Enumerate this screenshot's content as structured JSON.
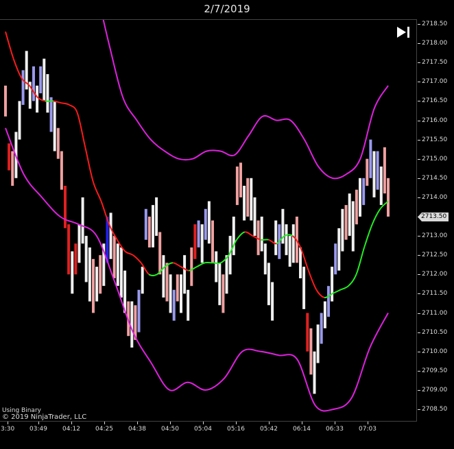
{
  "window": {
    "title": "2/7/2019"
  },
  "footer": {
    "binary_label": "Using Binary",
    "copyright": "© 2019 NinjaTrader, LLC"
  },
  "controls": {
    "scroll_to_end_icon": "skip-to-end-icon"
  },
  "current_price_label": "2713.50",
  "colors": {
    "background": "#000000",
    "upper_band": "#e020e0",
    "lower_band": "#e020e0",
    "ma_down": "#ff1a1a",
    "ma_up": "#22ee22",
    "bar_light": "#f0f0f0",
    "bar_pink": "#f0a0a0",
    "bar_blue": "#9999ee",
    "bar_red": "#e02020",
    "bar_darkblue": "#2222ee"
  },
  "chart_data": {
    "type": "bar",
    "x_axis_labels": [
      "3:30",
      "03:49",
      "04:12",
      "04:25",
      "04:38",
      "04:50",
      "05:04",
      "05:16",
      "05:42",
      "06:14",
      "06:33",
      "07:03"
    ],
    "y_axis_labels": [
      "2718.50",
      "2718.00",
      "2717.50",
      "2717.00",
      "2716.50",
      "2716.00",
      "2715.50",
      "2715.00",
      "2714.50",
      "2714.00",
      "2713.50",
      "2713.00",
      "2712.50",
      "2712.00",
      "2711.50",
      "2711.00",
      "2710.50",
      "2710.00",
      "2709.50",
      "2709.00",
      "2708.50"
    ],
    "ylim": [
      2708.35,
      2718.6
    ],
    "last_price": 2713.5,
    "bar_count": 94,
    "bars": [
      [
        2716.1,
        2716.9,
        "p"
      ],
      [
        2714.7,
        2715.4,
        "r"
      ],
      [
        2714.3,
        2715.2,
        "p"
      ],
      [
        2714.5,
        2715.7,
        "w"
      ],
      [
        2715.5,
        2716.5,
        "w"
      ],
      [
        2716.4,
        2717.3,
        "b"
      ],
      [
        2716.8,
        2717.8,
        "w"
      ],
      [
        2716.3,
        2717.0,
        "w"
      ],
      [
        2716.5,
        2717.4,
        "b"
      ],
      [
        2716.2,
        2716.9,
        "w"
      ],
      [
        2716.7,
        2717.4,
        "b"
      ],
      [
        2716.5,
        2717.6,
        "w"
      ],
      [
        2716.2,
        2717.2,
        "w"
      ],
      [
        2715.7,
        2716.6,
        "b"
      ],
      [
        2715.2,
        2716.5,
        "w"
      ],
      [
        2715.0,
        2715.8,
        "p"
      ],
      [
        2714.2,
        2715.2,
        "p"
      ],
      [
        2713.2,
        2714.3,
        "r"
      ],
      [
        2712.0,
        2713.3,
        "r"
      ],
      [
        2711.5,
        2712.6,
        "w"
      ],
      [
        2712.0,
        2712.8,
        "r"
      ],
      [
        2712.3,
        2713.3,
        "w"
      ],
      [
        2712.8,
        2714.0,
        "w"
      ],
      [
        2711.8,
        2713.0,
        "w"
      ],
      [
        2711.3,
        2712.7,
        "w"
      ],
      [
        2711.0,
        2712.4,
        "p"
      ],
      [
        2711.3,
        2712.2,
        "w"
      ],
      [
        2711.5,
        2712.5,
        "p"
      ],
      [
        2711.7,
        2712.8,
        "w"
      ],
      [
        2712.3,
        2713.5,
        "d"
      ],
      [
        2712.4,
        2713.6,
        "w"
      ],
      [
        2711.9,
        2713.0,
        "p"
      ],
      [
        2711.7,
        2712.8,
        "w"
      ],
      [
        2711.4,
        2712.7,
        "w"
      ],
      [
        2711.0,
        2712.1,
        "w"
      ],
      [
        2710.4,
        2711.3,
        "p"
      ],
      [
        2710.1,
        2711.3,
        "w"
      ],
      [
        2710.3,
        2711.2,
        "p"
      ],
      [
        2710.5,
        2711.6,
        "b"
      ],
      [
        2711.5,
        2712.2,
        "w"
      ],
      [
        2712.9,
        2713.7,
        "b"
      ],
      [
        2712.7,
        2713.5,
        "p"
      ],
      [
        2712.7,
        2713.8,
        "w"
      ],
      [
        2713.0,
        2714.0,
        "w"
      ],
      [
        2712.0,
        2713.1,
        "p"
      ],
      [
        2711.4,
        2712.5,
        "w"
      ],
      [
        2711.3,
        2712.3,
        "p"
      ],
      [
        2711.0,
        2712.0,
        "w"
      ],
      [
        2710.8,
        2711.6,
        "b"
      ],
      [
        2711.3,
        2712.0,
        "p"
      ],
      [
        2711.0,
        2712.0,
        "w"
      ],
      [
        2711.5,
        2712.5,
        "w"
      ],
      [
        2710.8,
        2711.6,
        "w"
      ],
      [
        2711.7,
        2712.7,
        "p"
      ],
      [
        2712.4,
        2713.3,
        "r"
      ],
      [
        2712.7,
        2713.4,
        "b"
      ],
      [
        2712.3,
        2713.3,
        "w"
      ],
      [
        2712.9,
        2713.7,
        "b"
      ],
      [
        2712.8,
        2713.9,
        "w"
      ],
      [
        2712.3,
        2713.4,
        "p"
      ],
      [
        2711.8,
        2712.6,
        "w"
      ],
      [
        2711.2,
        2712.3,
        "w"
      ],
      [
        2711.0,
        2712.0,
        "p"
      ],
      [
        2711.5,
        2712.5,
        "w"
      ],
      [
        2712.0,
        2713.0,
        "w"
      ],
      [
        2712.5,
        2713.5,
        "w"
      ],
      [
        2713.8,
        2714.8,
        "p"
      ],
      [
        2714.0,
        2714.9,
        "p"
      ],
      [
        2713.4,
        2714.3,
        "w"
      ],
      [
        2713.5,
        2714.5,
        "p"
      ],
      [
        2713.4,
        2714.5,
        "w"
      ],
      [
        2713.0,
        2714.0,
        "w"
      ],
      [
        2712.5,
        2713.4,
        "p"
      ],
      [
        2712.6,
        2713.5,
        "w"
      ],
      [
        2712.0,
        2712.8,
        "w"
      ],
      [
        2711.2,
        2712.3,
        "w"
      ],
      [
        2710.8,
        2711.8,
        "w"
      ],
      [
        2712.5,
        2713.4,
        "w"
      ],
      [
        2712.4,
        2713.3,
        "b"
      ],
      [
        2712.8,
        2713.7,
        "w"
      ],
      [
        2712.5,
        2713.3,
        "w"
      ],
      [
        2712.2,
        2713.0,
        "w"
      ],
      [
        2712.3,
        2713.3,
        "w"
      ],
      [
        2712.3,
        2713.5,
        "p"
      ],
      [
        2711.9,
        2712.7,
        "w"
      ],
      [
        2711.1,
        2712.2,
        "w"
      ],
      [
        2710.0,
        2711.0,
        "r"
      ],
      [
        2709.4,
        2710.6,
        "p"
      ],
      [
        2708.9,
        2710.0,
        "w"
      ],
      [
        2709.7,
        2710.7,
        "w"
      ]
    ],
    "bars_tail": [
      [
        2710.2,
        2711.0,
        "b"
      ],
      [
        2710.6,
        2711.3,
        "w"
      ],
      [
        2710.9,
        2711.7,
        "b"
      ],
      [
        2711.3,
        2712.2,
        "w"
      ],
      [
        2712.0,
        2712.8,
        "b"
      ],
      [
        2712.1,
        2713.2,
        "w"
      ],
      [
        2712.6,
        2713.7,
        "w"
      ],
      [
        2712.9,
        2713.8,
        "p"
      ],
      [
        2713.0,
        2714.1,
        "w"
      ],
      [
        2712.6,
        2713.9,
        "w"
      ],
      [
        2713.3,
        2714.2,
        "p"
      ],
      [
        2713.5,
        2714.5,
        "w"
      ],
      [
        2713.8,
        2714.5,
        "b"
      ],
      [
        2714.3,
        2715.0,
        "p"
      ],
      [
        2714.5,
        2715.5,
        "b"
      ],
      [
        2714.0,
        2715.2,
        "w"
      ],
      [
        2714.2,
        2715.2,
        "b"
      ],
      [
        2713.8,
        2714.8,
        "w"
      ],
      [
        2714.1,
        2715.3,
        "p"
      ],
      [
        2713.5,
        2714.5,
        "p"
      ]
    ],
    "ma_line": [
      2718.3,
      2717.6,
      2717.1,
      2716.9,
      2716.6,
      2716.5,
      2716.5,
      2716.45,
      2716.4,
      2716.2,
      2715.3,
      2714.4,
      2713.9,
      2713.3,
      2712.9,
      2712.6,
      2712.5,
      2712.3,
      2712.0,
      2712.0,
      2712.2,
      2712.3,
      2712.2,
      2712.1,
      2712.2,
      2712.3,
      2712.3,
      2712.3,
      2712.5,
      2712.9,
      2713.1,
      2713.0,
      2712.9,
      2712.9,
      2712.8,
      2713.0,
      2713.0,
      2712.7,
      2712.1,
      2711.6,
      2711.4,
      2711.5,
      2711.6,
      2711.7,
      2712.0,
      2712.7,
      2713.3,
      2713.7,
      2713.9
    ],
    "upper_band": [
      2720.5,
      2719.5,
      2718.0,
      2716.6,
      2716.0,
      2715.5,
      2715.2,
      2715.0,
      2715.0,
      2715.2,
      2715.2,
      2715.1,
      2715.6,
      2716.1,
      2716.0,
      2716.0,
      2715.5,
      2714.8,
      2714.5,
      2714.6,
      2715.0,
      2716.3,
      2716.9
    ],
    "lower_band": [
      2715.8,
      2714.6,
      2714.0,
      2713.5,
      2713.3,
      2713.0,
      2711.8,
      2710.5,
      2709.7,
      2709.0,
      2709.2,
      2709.0,
      2709.3,
      2710.0,
      2710.0,
      2709.9,
      2709.8,
      2708.6,
      2708.5,
      2708.8,
      2710.1,
      2711.0
    ]
  }
}
